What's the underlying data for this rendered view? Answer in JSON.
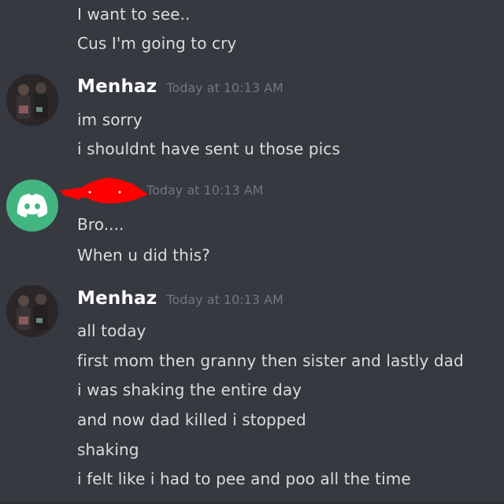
{
  "messages": [
    {
      "continuation": true,
      "lines": [
        "I want to see..",
        "Cus I'm going to cry"
      ]
    },
    {
      "author": "Menhaz",
      "timestamp": "Today at 10:13 AM",
      "avatar": "user-photo-avatar",
      "lines": [
        "im sorry",
        "i shouldnt have sent u those pics"
      ]
    },
    {
      "author": "",
      "author_redacted": true,
      "timestamp": "Today at 10:13 AM",
      "avatar": "discord-default-avatar",
      "avatar_color": "#43b581",
      "lines": [
        "Bro....",
        "When u did this?"
      ]
    },
    {
      "author": "Menhaz",
      "timestamp": "Today at 10:13 AM",
      "avatar": "user-photo-avatar",
      "lines": [
        "all today",
        "first mom then granny then sister and lastly dad",
        "i was shaking the entire day",
        "and now dad killed i stopped",
        "shaking",
        "i felt like i had to pee and poo all the time"
      ]
    }
  ],
  "colors": {
    "background": "#36393f",
    "message_text": "#dcddde",
    "author_text": "#ffffff",
    "timestamp_text": "#72767d",
    "redaction_scribble": "#ff0000"
  }
}
